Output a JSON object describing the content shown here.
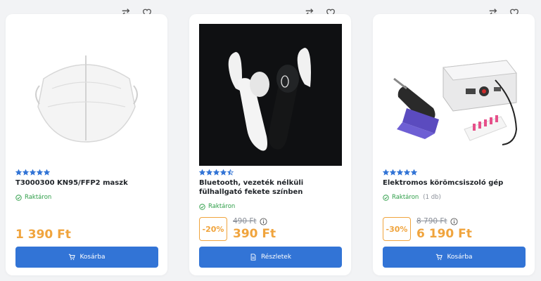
{
  "colors": {
    "accent": "#3274d6",
    "price": "#f0a43d",
    "in_stock": "#2e9e48"
  },
  "products": [
    {
      "title": "T3000300 KN95/FFP2 maszk",
      "rating": 5,
      "stock": "Raktáron",
      "stock_qty": "",
      "price": "1 390 Ft",
      "button": "Kosárba",
      "button_icon": "cart-icon"
    },
    {
      "title": "Bluetooth, vezeték nélküli fülhallgató fekete színben",
      "rating": 4.5,
      "stock": "Raktáron",
      "stock_qty": "",
      "discount": "-20%",
      "old_price": "490 Ft",
      "price": "390 Ft",
      "button": "Részletek",
      "button_icon": "document-icon"
    },
    {
      "title": "Elektromos körömcsiszoló gép",
      "rating": 5,
      "stock": "Raktáron",
      "stock_qty": "(1 db)",
      "discount": "-30%",
      "old_price": "8 790 Ft",
      "price": "6 190 Ft",
      "button": "Kosárba",
      "button_icon": "cart-icon"
    }
  ]
}
